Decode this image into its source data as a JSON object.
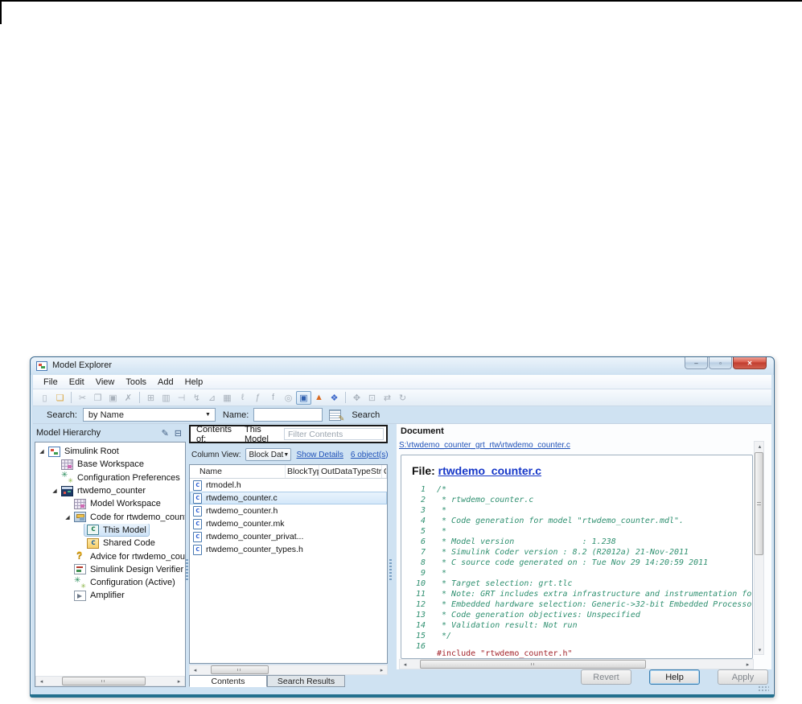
{
  "colors": {
    "window_frame_blue": "#cfe2f2",
    "window_border": "#35658c",
    "bottom_strip_teal": "#23708e",
    "close_button_red": "#bf3a2c",
    "link_blue": "#1f51b8",
    "file_link_blue": "#1536c8",
    "comment_green": "#2f9070",
    "include_maroon": "#a3232b",
    "selection_blue": "#cfe4f7"
  },
  "window": {
    "title": "Model Explorer",
    "controls": [
      {
        "name": "minimize",
        "glyph": "–"
      },
      {
        "name": "maximize",
        "glyph": "▫"
      },
      {
        "name": "close",
        "glyph": "✕"
      }
    ],
    "menu": [
      "File",
      "Edit",
      "View",
      "Tools",
      "Add",
      "Help"
    ],
    "toolbar": [
      {
        "name": "new-model-icon",
        "glyph": "▯",
        "state": "disabled"
      },
      {
        "name": "open-model-icon",
        "glyph": "❏",
        "state": "folder"
      },
      {
        "type": "sep"
      },
      {
        "name": "cut-icon",
        "glyph": "✂",
        "state": "disabled"
      },
      {
        "name": "copy-icon",
        "glyph": "❐",
        "state": "disabled"
      },
      {
        "name": "paste-icon",
        "glyph": "▣",
        "state": "disabled"
      },
      {
        "name": "delete-icon",
        "glyph": "✗",
        "state": "disabled"
      },
      {
        "type": "sep"
      },
      {
        "name": "add-object-icon",
        "glyph": "⊞",
        "state": "disabled"
      },
      {
        "name": "library-link-icon",
        "glyph": "▥",
        "state": "disabled"
      },
      {
        "name": "goto-parent-icon",
        "glyph": "⊣",
        "state": "disabled"
      },
      {
        "name": "signal-log-icon",
        "glyph": "↯",
        "state": "disabled"
      },
      {
        "name": "test-point-icon",
        "glyph": "⊿",
        "state": "disabled"
      },
      {
        "name": "data-table-icon",
        "glyph": "▦",
        "state": "disabled"
      },
      {
        "name": "script-icon",
        "glyph": "ℓ",
        "state": "disabled"
      },
      {
        "name": "function-icon",
        "glyph": "ƒ",
        "state": "disabled"
      },
      {
        "name": "function-call-icon",
        "glyph": "f",
        "state": "disabled"
      },
      {
        "name": "target-icon",
        "glyph": "◎",
        "state": "disabled"
      },
      {
        "name": "dialog-view-icon",
        "glyph": "▣",
        "state": "active"
      },
      {
        "name": "matlab-icon",
        "glyph": "▲",
        "state": "matlab"
      },
      {
        "name": "simulink-icon",
        "glyph": "❖",
        "state": "simulink"
      },
      {
        "type": "sep"
      },
      {
        "name": "pin-icon",
        "glyph": "✥",
        "state": "disabled"
      },
      {
        "name": "frame-icon",
        "glyph": "⊡",
        "state": "disabled"
      },
      {
        "name": "compare-icon",
        "glyph": "⇄",
        "state": "disabled"
      },
      {
        "name": "refresh-icon",
        "glyph": "↻",
        "state": "disabled"
      }
    ],
    "search": {
      "label": "Search:",
      "by_value": "by Name",
      "name_label": "Name:",
      "input_value": "",
      "button_label": "Search"
    }
  },
  "hierarchy": {
    "title": "Model Hierarchy",
    "items": [
      {
        "label": "Simulink Root",
        "level": 0,
        "icon": "simulink-root",
        "expanded": true
      },
      {
        "label": "Base Workspace",
        "level": 1,
        "icon": "workspace"
      },
      {
        "label": "Configuration Preferences",
        "level": 1,
        "icon": "gears"
      },
      {
        "label": "rtwdemo_counter",
        "level": 1,
        "icon": "model",
        "expanded": true
      },
      {
        "label": "Model Workspace",
        "level": 2,
        "icon": "workspace"
      },
      {
        "label": "Code for rtwdemo_counte",
        "level": 2,
        "icon": "code",
        "expanded": true
      },
      {
        "label": "This Model",
        "level": 3,
        "icon": "this-model",
        "selected": true
      },
      {
        "label": "Shared Code",
        "level": 3,
        "icon": "shared-code"
      },
      {
        "label": "Advice for rtwdemo_count",
        "level": 2,
        "icon": "advice"
      },
      {
        "label": "Simulink Design Verifier re",
        "level": 2,
        "icon": "sldv"
      },
      {
        "label": "Configuration (Active)",
        "level": 2,
        "icon": "gears"
      },
      {
        "label": "Amplifier",
        "level": 2,
        "icon": "amplifier"
      }
    ]
  },
  "contents": {
    "contents_of_label": "Contents of:",
    "contents_of_value": "This Model",
    "filter_placeholder": "Filter Contents",
    "column_view_label": "Column View:",
    "column_view_value": "Block Dat",
    "show_details": "Show Details",
    "objects_link": "6 object(s)",
    "table": {
      "columns": [
        "Name",
        "BlockType",
        "OutDataTypeStr",
        "Ou"
      ],
      "rows": [
        {
          "name": "rtmodel.h"
        },
        {
          "name": "rtwdemo_counter.c",
          "selected": true
        },
        {
          "name": "rtwdemo_counter.h"
        },
        {
          "name": "rtwdemo_counter.mk"
        },
        {
          "name": "rtwdemo_counter_privat..."
        },
        {
          "name": "rtwdemo_counter_types.h"
        }
      ]
    },
    "tabs": [
      {
        "label": "Contents",
        "active": true
      },
      {
        "label": "Search Results"
      }
    ]
  },
  "document": {
    "panel_label": "Document",
    "path_link": "S:\\rtwdemo_counter_grt_rtw\\rtwdemo_counter.c",
    "file_label": "File:",
    "file_link": "rtwdemo_counter.c",
    "code_lines": [
      {
        "num": 1,
        "text": "/*",
        "type": "comment"
      },
      {
        "num": 2,
        "text": " * rtwdemo_counter.c",
        "type": "comment"
      },
      {
        "num": 3,
        "text": " *",
        "type": "comment"
      },
      {
        "num": 4,
        "text": " * Code generation for model \"rtwdemo_counter.mdl\".",
        "type": "comment"
      },
      {
        "num": 5,
        "text": " *",
        "type": "comment"
      },
      {
        "num": 6,
        "text": " * Model version              : 1.238",
        "type": "comment"
      },
      {
        "num": 7,
        "text": " * Simulink Coder version : 8.2 (R2012a) 21-Nov-2011",
        "type": "comment"
      },
      {
        "num": 8,
        "text": " * C source code generated on : Tue Nov 29 14:20:59 2011",
        "type": "comment"
      },
      {
        "num": 9,
        "text": " *",
        "type": "comment"
      },
      {
        "num": 10,
        "text": " * Target selection: grt.tlc",
        "type": "comment"
      },
      {
        "num": 11,
        "text": " * Note: GRT includes extra infrastructure and instrumentation fo",
        "type": "comment"
      },
      {
        "num": 12,
        "text": " * Embedded hardware selection: Generic->32-bit Embedded Processo",
        "type": "comment"
      },
      {
        "num": 13,
        "text": " * Code generation objectives: Unspecified",
        "type": "comment"
      },
      {
        "num": 14,
        "text": " * Validation result: Not run",
        "type": "comment"
      },
      {
        "num": 15,
        "text": " */",
        "type": "comment"
      },
      {
        "num": 16,
        "text": "#include \"rtwdemo_counter.h\"",
        "type": "code"
      }
    ],
    "buttons": [
      {
        "label": "Revert",
        "state": "dim"
      },
      {
        "label": "Help",
        "state": "focus"
      },
      {
        "label": "Apply",
        "state": "dim"
      }
    ]
  }
}
